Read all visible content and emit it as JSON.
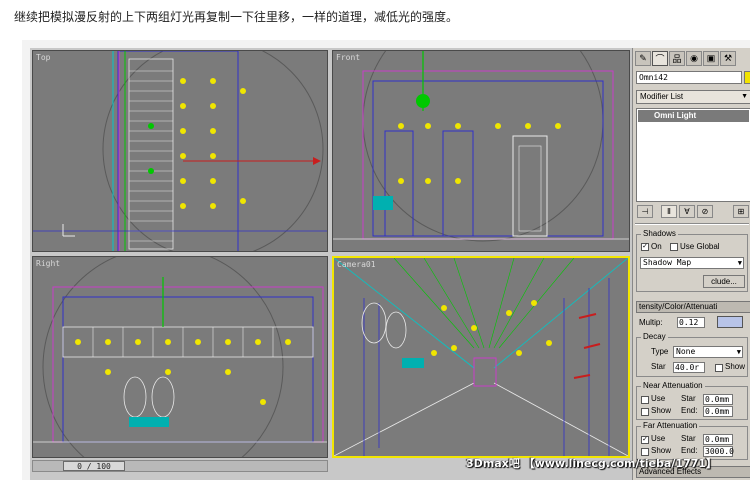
{
  "caption": "继续把模拟漫反射的上下两组灯光再复制一下往里移，一样的道理，减低光的强度。",
  "viewports": {
    "top": {
      "label": "Top"
    },
    "front": {
      "label": "Front"
    },
    "right": {
      "label": "Right"
    },
    "camera": {
      "label": "Camera01"
    }
  },
  "timebar": {
    "frame": "0 / 100"
  },
  "panel": {
    "tabs": [
      "create-icon",
      "modify-icon",
      "hierarchy-icon",
      "motion-icon",
      "display-icon",
      "utilities-icon"
    ],
    "object_name": "Omni42",
    "object_color": "#f2e300",
    "modifier_list": "Modifier List",
    "stack_item": "Omni Light",
    "shadows": {
      "title": "Shadows",
      "on_label": "On",
      "use_global_label": "Use Global",
      "type": "Shadow Map",
      "exclude_label": "clude..."
    },
    "intensity": {
      "title": "tensity/Color/Attenuati",
      "multiplier_label": "Multip:",
      "multiplier": "0.12",
      "color": "#b8c4e8"
    },
    "decay": {
      "title": "Decay",
      "type_label": "Type",
      "type": "None",
      "start_label": "Star",
      "start": "40.0r",
      "show_label": "Show"
    },
    "near": {
      "title": "Near Attenuation",
      "use_label": "Use",
      "show_label": "Show",
      "start_label": "Star",
      "start": "0.0mm",
      "end_label": "End:",
      "end": "0.0mm"
    },
    "far": {
      "title": "Far Attenuation",
      "use_label": "Use",
      "show_label": "Show",
      "start_label": "Star",
      "start": "0.0mm",
      "end_label": "End:",
      "end": "3000.0"
    },
    "advanced": "Advanced Effects"
  },
  "watermark": "3Dmax吧 【www.linecg.com/tieba/1771】"
}
